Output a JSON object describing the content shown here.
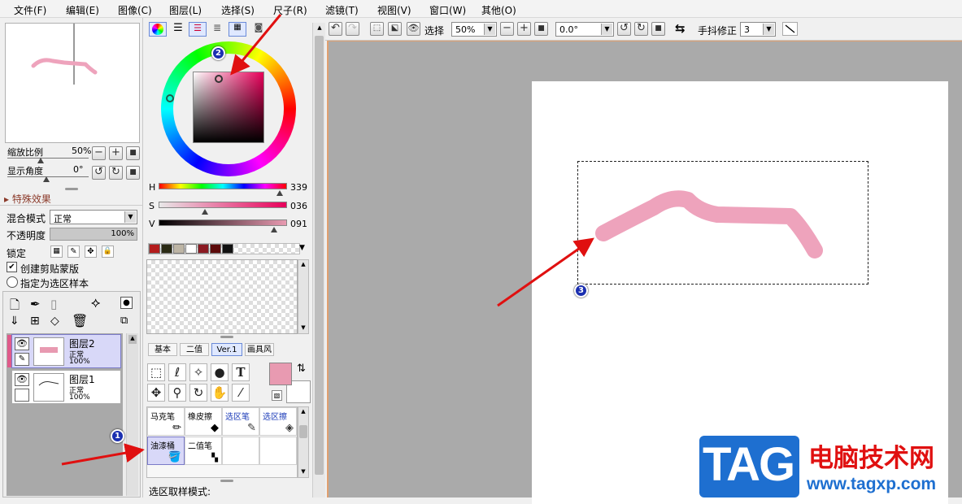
{
  "menu": [
    "文件(F)",
    "编辑(E)",
    "图像(C)",
    "图层(L)",
    "选择(S)",
    "尺子(R)",
    "滤镜(T)",
    "视图(V)",
    "窗口(W)",
    "其他(O)"
  ],
  "navigator": {
    "zoom_label": "缩放比例",
    "zoom_value": "50%",
    "angle_label": "显示角度",
    "angle_value": "0°"
  },
  "effects_label": "特殊效果",
  "layer_props": {
    "blend_label": "混合模式",
    "blend_value": "正常",
    "opacity_label": "不透明度",
    "opacity_value": "100%",
    "lock_label": "锁定",
    "clip_label": "创建剪贴蒙版",
    "sample_label": "指定为选区样本"
  },
  "layers": [
    {
      "name": "图层2",
      "mode": "正常",
      "opacity": "100%"
    },
    {
      "name": "图层1",
      "mode": "正常",
      "opacity": "100%"
    }
  ],
  "color": {
    "h_label": "H",
    "h_value": "339",
    "s_label": "S",
    "s_value": "036",
    "v_label": "V",
    "v_value": "091",
    "current": "#e89ab1",
    "swatches": [
      "#b31b1b",
      "#2a2a14",
      "#bdb5a5",
      "#ffffff",
      "#8b1a22",
      "#5c0a0a",
      "#111111"
    ]
  },
  "tool_tabs": [
    "基本",
    "二值",
    "Ver.1",
    "画具风"
  ],
  "brushes": [
    {
      "label": "马克笔",
      "link": false
    },
    {
      "label": "橡皮擦",
      "link": false
    },
    {
      "label": "选区笔",
      "link": true
    },
    {
      "label": "选区擦",
      "link": true
    },
    {
      "label": "油漆桶",
      "link": false
    },
    {
      "label": "二值笔",
      "link": false
    }
  ],
  "selection_mode_label": "选区取样模式:",
  "toolbar": {
    "select_label": "选择",
    "zoom_value": "50%",
    "angle_value": "0.0°",
    "stabilizer_label": "手抖修正",
    "stabilizer_value": "3"
  },
  "annotations": [
    "1",
    "2",
    "3"
  ],
  "watermark": {
    "logo": "TAG",
    "title": "电脑技术网",
    "url": "www.tagxp.com"
  },
  "colors": {
    "accent_stroke": "#eea3bc",
    "arrow": "#e01010",
    "badge": "#1b2fb0",
    "active_layer": "#d8d8f8"
  }
}
